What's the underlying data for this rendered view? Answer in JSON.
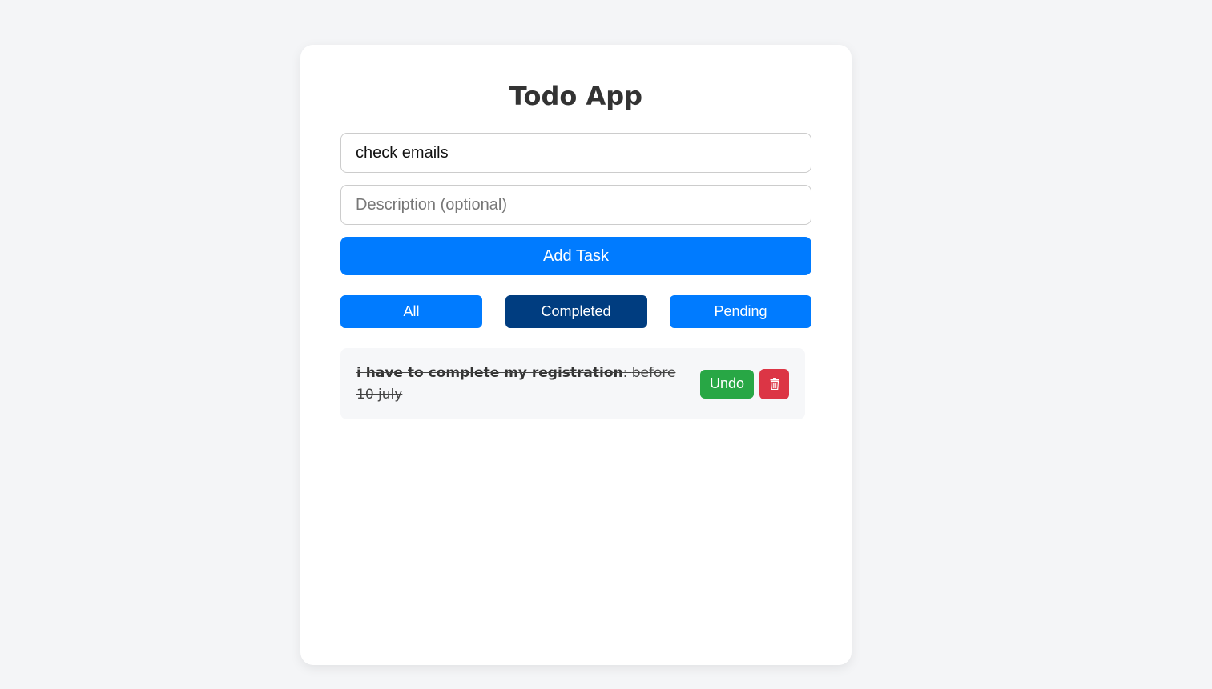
{
  "app": {
    "title": "Todo App"
  },
  "form": {
    "title_value": "check emails",
    "title_placeholder": "",
    "description_value": "",
    "description_placeholder": "Description (optional)",
    "add_label": "Add Task"
  },
  "filters": {
    "items": [
      {
        "label": "All",
        "active": false
      },
      {
        "label": "Completed",
        "active": true
      },
      {
        "label": "Pending",
        "active": false
      }
    ]
  },
  "tasks": [
    {
      "title": "i have to complete my registration",
      "separator": ": ",
      "description": "before 10 july",
      "completed": true,
      "undo_label": "Undo",
      "delete_icon": "trash-icon"
    }
  ],
  "colors": {
    "primary": "#007bff",
    "active_filter": "#003d80",
    "success": "#28a745",
    "danger": "#dc3545",
    "background": "#f4f5f7"
  }
}
